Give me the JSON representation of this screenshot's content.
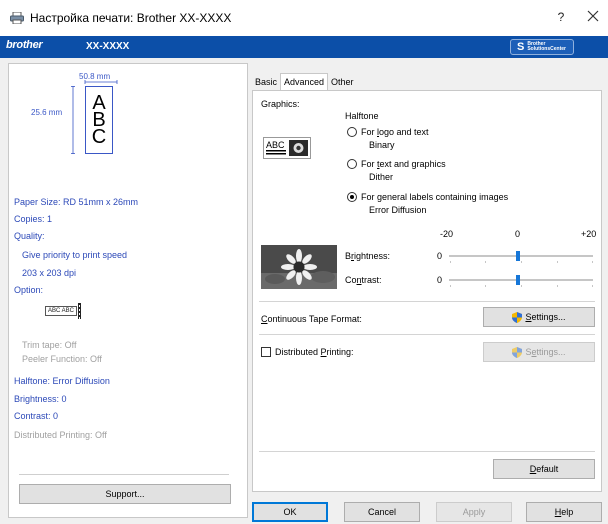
{
  "window": {
    "title": "Настройка печати: Brother XX-XXXX",
    "help_label": "?",
    "app_icon": "printer-icon",
    "close_icon": "close-icon"
  },
  "brand": {
    "logo": "brother",
    "model": "XX-XXXX",
    "solutions": {
      "line1": "Brother",
      "line2": "SolutionsCenter",
      "icon": "s-logo-icon"
    }
  },
  "preview": {
    "width": "50.8 mm",
    "height": "25.6 mm",
    "letters": [
      "A",
      "B",
      "C"
    ]
  },
  "summary": {
    "paper_size": "Paper Size: RD 51mm x 26mm",
    "copies": "Copies: 1",
    "quality": "Quality:",
    "quality_value": "Give priority to print speed",
    "resolution": "203 x 203 dpi",
    "option": "Option:",
    "option_stamp": "ABC ABC",
    "trim_tape": "Trim tape: Off",
    "peeler": "Peeler Function: Off",
    "halftone": "Halftone: Error Diffusion",
    "brightness": "Brightness:  0",
    "contrast": "Contrast:  0",
    "distributed": "Distributed Printing: Off"
  },
  "support_button": {
    "text": "Support..."
  },
  "tabs": [
    {
      "label": "Basic",
      "active": false
    },
    {
      "label": "Advanced",
      "active": true
    },
    {
      "label": "Other",
      "active": false
    }
  ],
  "advanced": {
    "graphics_label": "Graphics:",
    "halftone_label": "Halftone",
    "options": [
      {
        "label_pre": "For ",
        "label_key": "l",
        "label_post": "ogo and text",
        "sub": "Binary",
        "checked": false
      },
      {
        "label_pre": "For ",
        "label_key": "t",
        "label_post": "ext and graphics",
        "sub": "Dither",
        "checked": false
      },
      {
        "label_pre": "For ",
        "label_key": "g",
        "label_post": "eneral labels containing images",
        "sub": "Error Diffusion",
        "checked": true
      }
    ],
    "scale": {
      "min": "-20",
      "mid": "0",
      "max": "+20"
    },
    "brightness": {
      "label_pre": "B",
      "label_key": "r",
      "label_post": "ightness:",
      "value": "0",
      "level": 0
    },
    "contrast": {
      "label_pre": "Co",
      "label_key": "n",
      "label_post": "trast:",
      "value": "0",
      "level": 0
    },
    "continuous_tape": {
      "label_pre": "",
      "label_key": "C",
      "label_post": "ontinuous Tape Format:",
      "button": "Settings...",
      "button_key": "S",
      "button_rest": "ettings..."
    },
    "distributed": {
      "label_pre": "Distributed ",
      "label_key": "P",
      "label_post": "rinting:",
      "checked": false,
      "button_pre": "S",
      "button_key": "e",
      "button_rest": "ttings..."
    },
    "default_button": {
      "key": "D",
      "rest": "efault"
    }
  },
  "footer": {
    "ok": "OK",
    "cancel": "Cancel",
    "apply": "Apply",
    "help_key": "H",
    "help_rest": "elp"
  },
  "colors": {
    "brand_blue": "#0c4fa8",
    "summary_text": "#2c49b8",
    "slider_thumb": "#1677d8"
  }
}
